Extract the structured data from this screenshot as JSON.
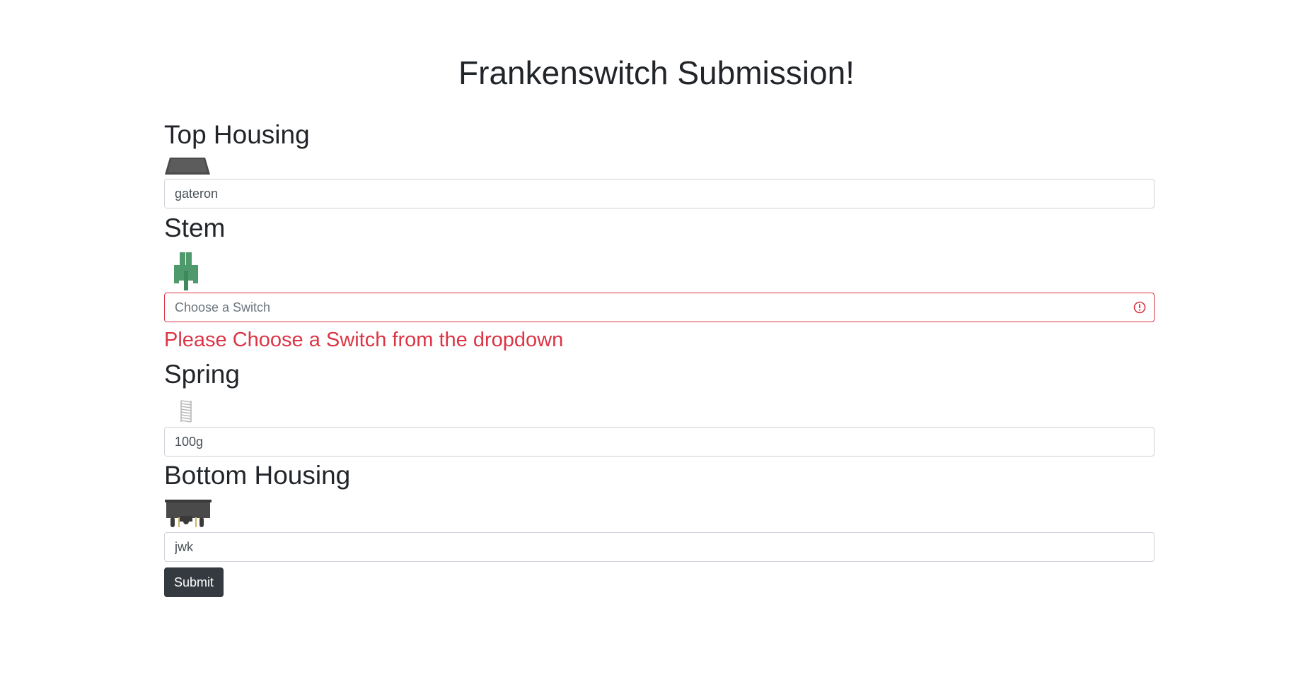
{
  "page": {
    "title": "Frankenswitch Submission!"
  },
  "sections": {
    "top_housing": {
      "heading": "Top Housing",
      "image_icon": "top-housing-icon",
      "value": "gateron"
    },
    "stem": {
      "heading": "Stem",
      "image_icon": "stem-icon",
      "value": "",
      "placeholder": "Choose a Switch",
      "error": "Please Choose a Switch from the dropdown",
      "error_icon": "exclamation-circle-icon"
    },
    "spring": {
      "heading": "Spring",
      "image_icon": "spring-icon",
      "value": "100g"
    },
    "bottom_housing": {
      "heading": "Bottom Housing",
      "image_icon": "bottom-housing-icon",
      "value": "jwk"
    }
  },
  "actions": {
    "submit_label": "Submit"
  },
  "colors": {
    "error": "#dc3545",
    "button": "#343a40",
    "stem_green": "#4f9a6c",
    "housing_gray": "#4a4a4a"
  }
}
